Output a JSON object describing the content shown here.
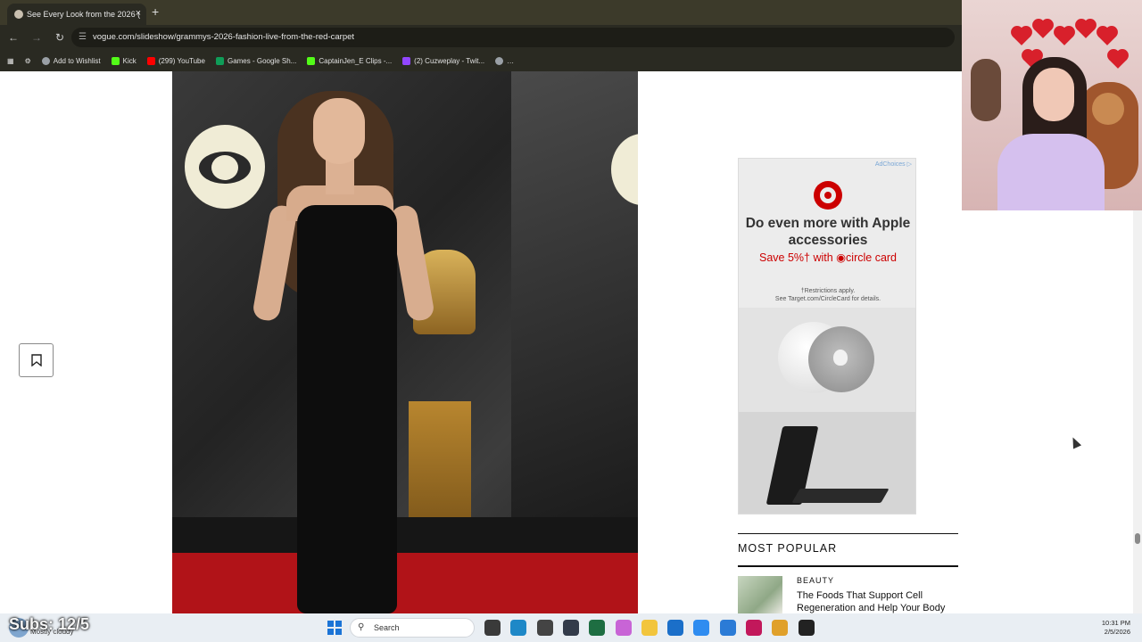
{
  "browser": {
    "tab_title": "See Every Look from the 2026 (",
    "tab_close": "×",
    "new_tab": "+",
    "url": "vogue.com/slideshow/grammys-2026-fashion-live-from-the-red-carpet",
    "bookmarks": [
      {
        "label": "Add to Wishlist",
        "icon": "wishlist-icon",
        "color": "#9aa0a6"
      },
      {
        "label": "Kick",
        "icon": "kick-icon",
        "color": "#53fc18"
      },
      {
        "label": "(299) YouTube",
        "icon": "youtube-icon",
        "color": "#ff0000"
      },
      {
        "label": "Games - Google Sh...",
        "icon": "sheets-icon",
        "color": "#0f9d58"
      },
      {
        "label": "CaptainJen_E Clips -...",
        "icon": "kick-icon",
        "color": "#53fc18"
      },
      {
        "label": "(2) Cuzweplay - Twit...",
        "icon": "twitch-icon",
        "color": "#9146ff"
      },
      {
        "label": "…",
        "icon": "globe-icon",
        "color": "#9aa0a6"
      }
    ]
  },
  "ad": {
    "adchoices": "AdChoices ▷",
    "headline": "Do even more with Apple accessories",
    "save_text": "Save 5%† with ◉circle card",
    "fine_print_1": "†Restrictions apply.",
    "fine_print_2": "See Target.com/CircleCard for details.",
    "brand_color": "#cc0000"
  },
  "most_popular": {
    "title": "MOST POPULAR",
    "items": [
      {
        "category": "BEAUTY",
        "headline": "The Foods That Support Cell Regeneration and Help Your Body"
      }
    ]
  },
  "overlay": {
    "subs": "Subs: 12/5"
  },
  "taskbar": {
    "weather": "Mostly cloudy",
    "search_placeholder": "Search",
    "time": "10:31 PM",
    "date": "2/5/2026",
    "apps": [
      {
        "name": "file-explorer-icon",
        "color": "#3a3a3a"
      },
      {
        "name": "edge-icon",
        "color": "#1e88c7"
      },
      {
        "name": "obs-icon",
        "color": "#444444"
      },
      {
        "name": "app-icon",
        "color": "#333b4a"
      },
      {
        "name": "excel-icon",
        "color": "#1e6e42"
      },
      {
        "name": "copilot-icon",
        "color": "#c864d6"
      },
      {
        "name": "folder-icon",
        "color": "#f2c53d"
      },
      {
        "name": "store-icon",
        "color": "#1b6fc9"
      },
      {
        "name": "azure-icon",
        "color": "#2f8cf0"
      },
      {
        "name": "outlook-icon",
        "color": "#2b7bd6"
      },
      {
        "name": "tiktok-icon",
        "color": "#c2185b"
      },
      {
        "name": "chrome-icon",
        "color": "#e0a02a"
      },
      {
        "name": "4k-icon",
        "color": "#222222"
      }
    ]
  }
}
